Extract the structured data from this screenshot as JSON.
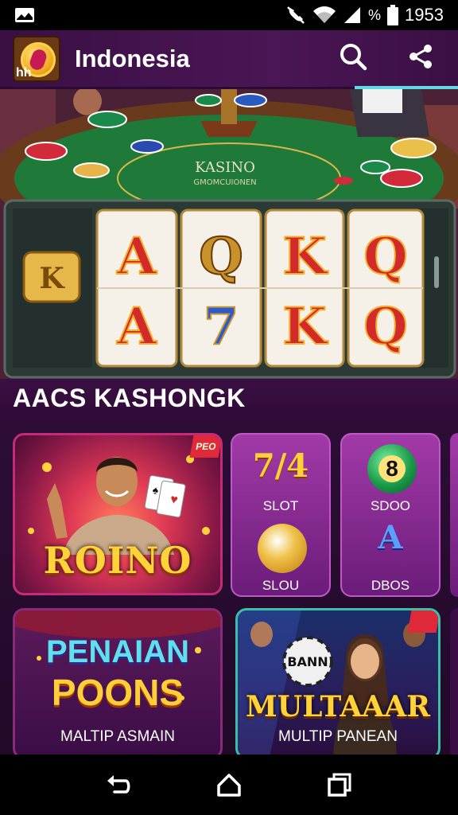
{
  "status_bar": {
    "time": "1953",
    "battery_percent_symbol": "%",
    "icons": [
      "image-icon",
      "mute-icon",
      "wifi-icon",
      "signal-icon",
      "battery-icon"
    ]
  },
  "app_bar": {
    "title": "Indonesia",
    "logo_text": "hh",
    "icons": [
      "search-icon",
      "share-icon"
    ]
  },
  "hero": {
    "table_title": "KASINO",
    "table_subtitle": "GMOMCUIONEN",
    "side_symbol": "K",
    "reels_top": [
      "A",
      "Q",
      "K",
      "Q"
    ],
    "reels_bottom": [
      "A",
      "7",
      "K",
      "Q"
    ]
  },
  "section": {
    "title": "AACS KASHONGK"
  },
  "tiles": {
    "roino": {
      "title": "ROINO",
      "badge": "РЕО"
    },
    "slot_a": {
      "title": "7/4",
      "label": "SLOT"
    },
    "slot_b": {
      "title": "8",
      "label": "SDOO"
    },
    "slot_c": {
      "label": "SLOU"
    },
    "slot_d": {
      "title": "A",
      "label": "DBOS"
    },
    "penaian": {
      "line1": "PENAIAN",
      "line2": "POONS",
      "caption": "MALTIP ASMAIN"
    },
    "multaaar": {
      "title": "MULTAAAR",
      "caption": "MULTIP PANEAN",
      "banner": "BANN"
    }
  },
  "nav_bar": {
    "icons": [
      "back-icon",
      "home-icon",
      "recents-icon"
    ]
  },
  "colors": {
    "primary_purple": "#3a1244",
    "gold": "#ffd23a",
    "accent_cyan": "#62d8e6"
  }
}
